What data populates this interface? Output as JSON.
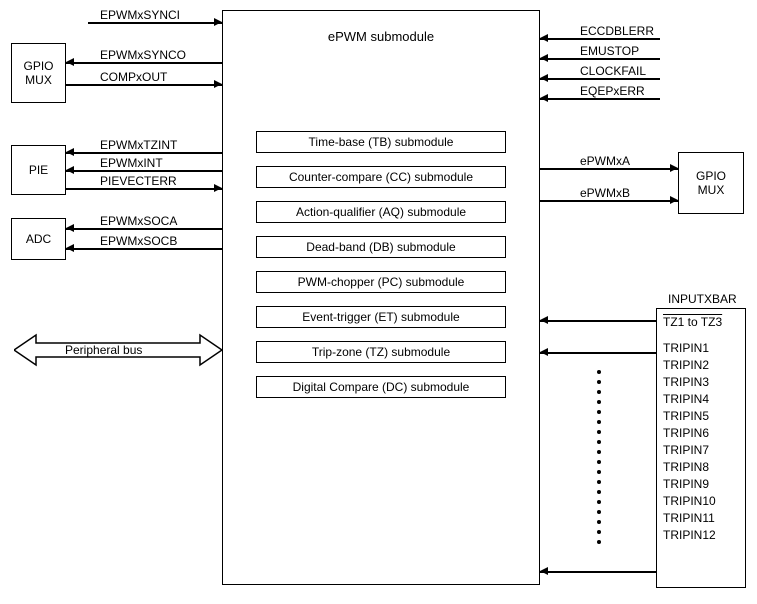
{
  "main": {
    "title": "ePWM submodule"
  },
  "sub": {
    "tb": "Time-base (TB) submodule",
    "cc": "Counter-compare (CC) submodule",
    "aq": "Action-qualifier (AQ) submodule",
    "db": "Dead-band (DB) submodule",
    "pc": "PWM-chopper (PC) submodule",
    "et": "Event-trigger (ET) submodule",
    "tz": "Trip-zone (TZ) submodule",
    "dc": "Digital Compare (DC) submodule"
  },
  "left_blocks": {
    "gpio_mux": "GPIO\nMUX",
    "pie": "PIE",
    "adc": "ADC"
  },
  "right_blocks": {
    "gpio_mux": "GPIO\nMUX",
    "inputxbar_title": "INPUTXBAR"
  },
  "signals_left": {
    "synci": "EPWMxSYNCI",
    "synco": "EPWMxSYNCO",
    "compxout": "COMPxOUT",
    "tzint": "EPWMxTZINT",
    "xint": "EPWMxINT",
    "pievecterr": "PIEVECTERR",
    "soca": "EPWMxSOCA",
    "socb": "EPWMxSOCB",
    "pbus": "Peripheral bus"
  },
  "signals_right_top": {
    "eccdblerr": "ECCDBLERR",
    "emustop": "EMUSTOP",
    "clockfail": "CLOCKFAIL",
    "eqepxerr": "EQEPxERR"
  },
  "signals_right_mid": {
    "epwmxa": "ePWMxA",
    "epwmxb": "ePWMxB"
  },
  "inputxbar": {
    "tz": "TZ1 to TZ3",
    "trip": [
      "TRIPIN1",
      "TRIPIN2",
      "TRIPIN3",
      "TRIPIN4",
      "TRIPIN5",
      "TRIPIN6",
      "TRIPIN7",
      "TRIPIN8",
      "TRIPIN9",
      "TRIPIN10",
      "TRIPIN11",
      "TRIPIN12"
    ]
  }
}
